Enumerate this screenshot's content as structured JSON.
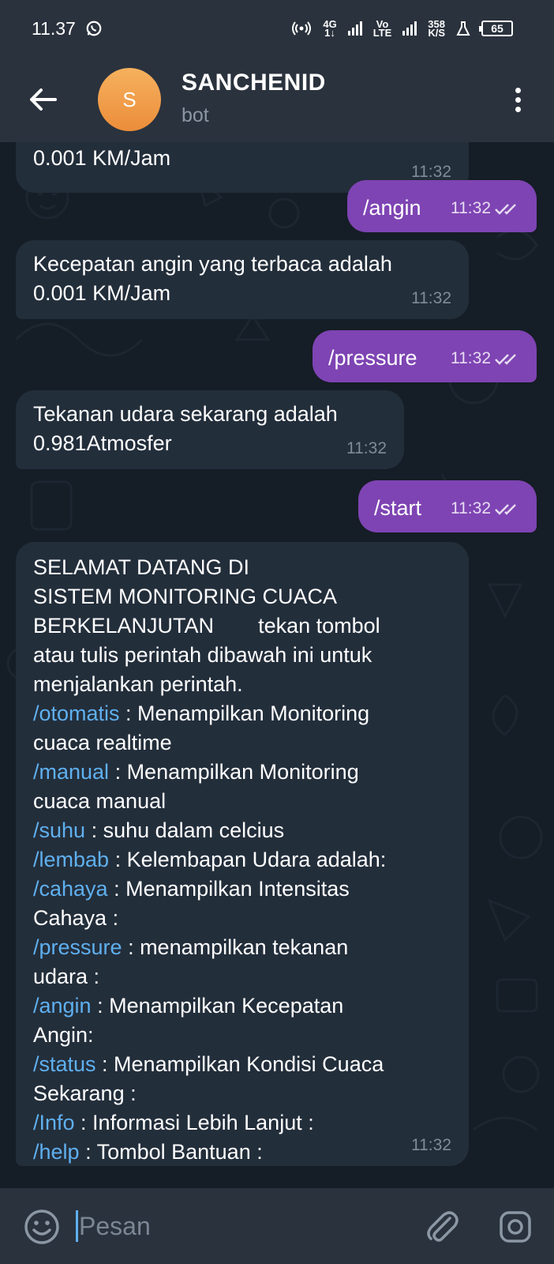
{
  "status_bar": {
    "time": "11.37",
    "net_top": "4G",
    "net_bottom": "1↓",
    "volte_top": "Vo",
    "volte_bottom": "LTE",
    "speed_top": "358",
    "speed_bottom": "K/S",
    "battery": "65"
  },
  "header": {
    "avatar_letter": "S",
    "title": "SANCHENID",
    "subtitle": "bot"
  },
  "messages": [
    {
      "side": "in",
      "text": "0.001  KM/Jam",
      "time": "11:32"
    },
    {
      "side": "out",
      "text": "/angin",
      "time": "11:32"
    },
    {
      "side": "in",
      "line1": "Kecepatan angin yang terbaca adalah",
      "line2": "0.001  KM/Jam",
      "time": "11:32"
    },
    {
      "side": "out",
      "text": "/pressure",
      "time": "11:32"
    },
    {
      "side": "in",
      "line1": "Tekanan udara sekarang adalah",
      "line2": "0.981Atmosfer",
      "time": "11:32"
    },
    {
      "side": "out",
      "text": "/start",
      "time": "11:32"
    }
  ],
  "welcome": {
    "l1": "SELAMAT DATANG DI",
    "l2": "SISTEM MONITORING CUACA",
    "l3a": "BERKELANJUTAN",
    "l3b": "tekan tombol",
    "l4": "atau tulis perintah dibawah ini untuk",
    "l5": "menjalankan perintah.",
    "c1": "/otomatis",
    "d1a": " : Menampilkan Monitoring",
    "d1b": "cuaca realtime",
    "c2": "/manual",
    "d2a": " : Menampilkan Monitoring",
    "d2b": "cuaca manual",
    "c3": "/suhu",
    "d3": " : suhu dalam celcius",
    "c4": "/lembab",
    "d4": " : Kelembapan Udara adalah:",
    "c5": "/cahaya",
    "d5a": " : Menampilkan Intensitas",
    "d5b": "Cahaya  :",
    "c6": "/pressure",
    "d6a": " : menampilkan tekanan",
    "d6b": "udara :",
    "c7": "/angin",
    "d7a": " : Menampilkan Kecepatan",
    "d7b": "Angin:",
    "c8": "/status",
    "d8a": " : Menampilkan Kondisi Cuaca",
    "d8b": "Sekarang :",
    "c9": "/Info",
    "d9": " : Informasi Lebih Lanjut :",
    "c10": "/help",
    "d10": " : Tombol Bantuan :",
    "time": "11:32"
  },
  "input": {
    "placeholder": "Pesan"
  },
  "colors": {
    "outgoing_bubble": "#7e44b3",
    "incoming_bubble": "#232e3b",
    "command_link": "#5fb0ef",
    "header": "#2a323d"
  }
}
